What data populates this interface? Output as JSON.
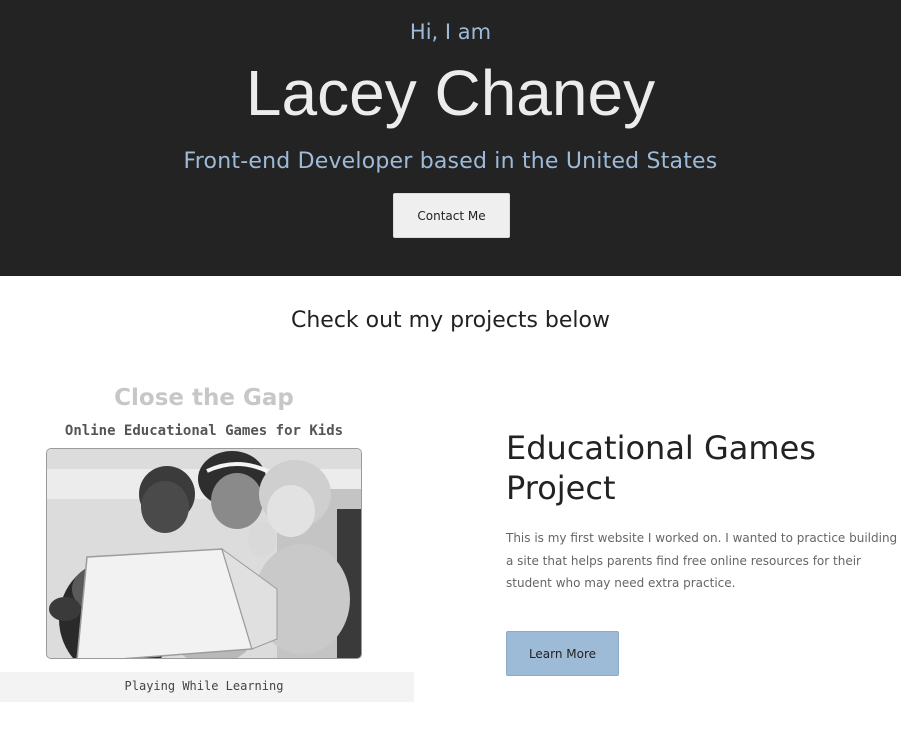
{
  "hero": {
    "greeting": "Hi, I am",
    "name": "Lacey Chaney",
    "tagline": "Front-end Developer based in the United States",
    "contact_label": "Contact Me"
  },
  "projects_section": {
    "heading": "Check out my projects below"
  },
  "project": {
    "image": {
      "title": "Close the Gap",
      "subtitle": "Online Educational Games for Kids",
      "caption": "Playing While Learning"
    },
    "title": "Educational Games Project",
    "description": "This is my first website I worked on. I wanted to practice building a site that helps parents find free online resources for their student who may need extra practice.",
    "button_label": "Learn More"
  },
  "colors": {
    "hero_bg": "#232323",
    "accent": "#9dbbd9",
    "button_accent": "#9dbbd6"
  }
}
